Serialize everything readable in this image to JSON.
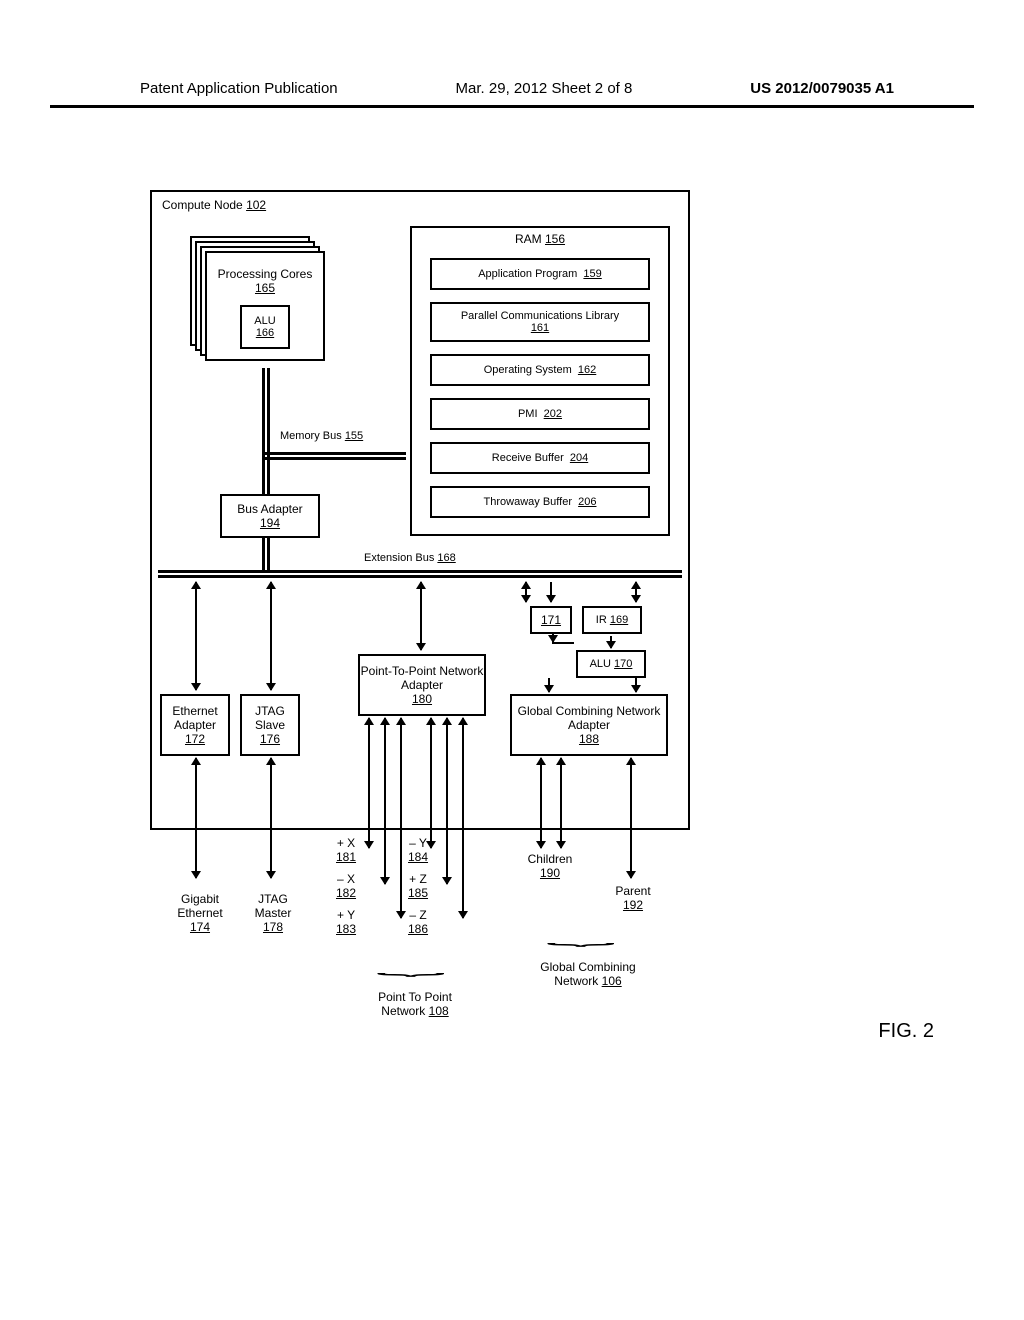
{
  "header": {
    "left": "Patent Application Publication",
    "center": "Mar. 29, 2012  Sheet 2 of 8",
    "right": "US 2012/0079035 A1"
  },
  "figure_label": "FIG. 2",
  "compute_node": {
    "label": "Compute Node",
    "ref": "102"
  },
  "cores": {
    "label": "Processing Cores",
    "ref": "165"
  },
  "alu": {
    "label": "ALU",
    "ref": "166"
  },
  "mem_bus": {
    "label": "Memory Bus",
    "ref": "155"
  },
  "bus_adapter": {
    "label": "Bus Adapter",
    "ref": "194"
  },
  "ext_bus": {
    "label": "Extension Bus",
    "ref": "168"
  },
  "ram": {
    "label": "RAM",
    "ref": "156",
    "items": [
      {
        "label": "Application Program",
        "ref": "159"
      },
      {
        "label": "Parallel Communications Library",
        "ref": "161"
      },
      {
        "label": "Operating System",
        "ref": "162"
      },
      {
        "label": "PMI",
        "ref": "202"
      },
      {
        "label": "Receive Buffer",
        "ref": "204"
      },
      {
        "label": "Throwaway Buffer",
        "ref": "206"
      }
    ]
  },
  "reg171": {
    "ref": "171"
  },
  "ir": {
    "label": "IR",
    "ref": "169"
  },
  "alu2": {
    "label": "ALU",
    "ref": "170"
  },
  "gcn": {
    "label": "Global Combining Network Adapter",
    "ref": "188"
  },
  "p2p": {
    "label": "Point-To-Point Network Adapter",
    "ref": "180"
  },
  "eth": {
    "label": "Ethernet Adapter",
    "ref": "172"
  },
  "jtag": {
    "label": "JTAG Slave",
    "ref": "176"
  },
  "gigabit": {
    "label": "Gigabit Ethernet",
    "ref": "174"
  },
  "jtag_master": {
    "label": "JTAG Master",
    "ref": "178"
  },
  "dirs": {
    "px": {
      "label": "+ X",
      "ref": "181"
    },
    "mx": {
      "label": "– X",
      "ref": "182"
    },
    "py": {
      "label": "+ Y",
      "ref": "183"
    },
    "my": {
      "label": "– Y",
      "ref": "184"
    },
    "pz": {
      "label": "+ Z",
      "ref": "185"
    },
    "mz": {
      "label": "– Z",
      "ref": "186"
    }
  },
  "children": {
    "label": "Children",
    "ref": "190"
  },
  "parent": {
    "label": "Parent",
    "ref": "192"
  },
  "ptp_net": {
    "label": "Point To Point Network",
    "ref": "108"
  },
  "gcn_net": {
    "label": "Global Combining Network",
    "ref": "106"
  }
}
